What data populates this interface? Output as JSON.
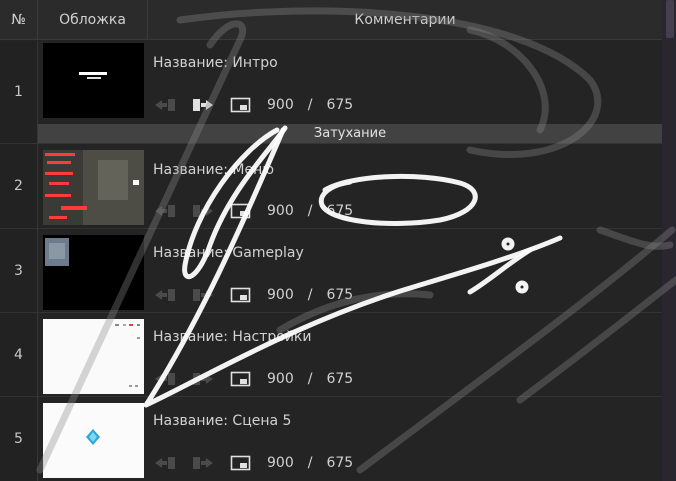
{
  "header": {
    "num": "№",
    "cover": "Обложка",
    "comments": "Комментарии"
  },
  "title_prefix": "Название: ",
  "size_sep": "/",
  "rows": [
    {
      "num": "1",
      "title": "Интро",
      "width": "900",
      "height": "675",
      "thumb": "intro-black"
    },
    {
      "num": "2",
      "title": "Меню",
      "width": "900",
      "height": "675",
      "thumb": "menu-dark"
    },
    {
      "num": "3",
      "title": "Gameplay",
      "width": "900",
      "height": "675",
      "thumb": "gameplay-black"
    },
    {
      "num": "4",
      "title": "Настройки",
      "width": "900",
      "height": "675",
      "thumb": "settings-white"
    },
    {
      "num": "5",
      "title": "Сцена 5",
      "width": "900",
      "height": "675",
      "thumb": "scene5-white"
    }
  ],
  "transition_label": "Затухание",
  "colors": {
    "bg": "#242424",
    "header": "#2b2b2b",
    "transition": "#424242",
    "icon_active": "#e0e0e0",
    "icon_dim": "#4a4a4a"
  }
}
